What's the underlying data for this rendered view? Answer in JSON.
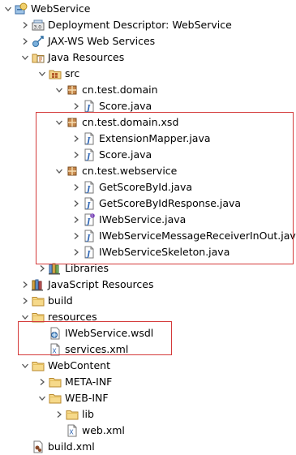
{
  "accent_highlight_color": "#d43a3a",
  "tree": [
    {
      "label": "WebService",
      "depth": 0,
      "arrow": "open",
      "icon": "project-icon"
    },
    {
      "label": "Deployment Descriptor: WebService",
      "depth": 1,
      "arrow": "closed",
      "icon": "deployment-descriptor-icon"
    },
    {
      "label": "JAX-WS Web Services",
      "depth": 1,
      "arrow": "closed",
      "icon": "jaxws-icon"
    },
    {
      "label": "Java Resources",
      "depth": 1,
      "arrow": "open",
      "icon": "java-resources-icon"
    },
    {
      "label": "src",
      "depth": 2,
      "arrow": "open",
      "icon": "source-folder-icon"
    },
    {
      "label": "cn.test.domain",
      "depth": 3,
      "arrow": "open",
      "icon": "package-icon"
    },
    {
      "label": "Score.java",
      "depth": 4,
      "arrow": "closed",
      "icon": "java-file-icon"
    },
    {
      "label": "cn.test.domain.xsd",
      "depth": 3,
      "arrow": "open",
      "icon": "package-icon"
    },
    {
      "label": "ExtensionMapper.java",
      "depth": 4,
      "arrow": "closed",
      "icon": "java-file-icon"
    },
    {
      "label": "Score.java",
      "depth": 4,
      "arrow": "closed",
      "icon": "java-file-icon"
    },
    {
      "label": "cn.test.webservice",
      "depth": 3,
      "arrow": "open",
      "icon": "package-icon"
    },
    {
      "label": "GetScoreById.java",
      "depth": 4,
      "arrow": "closed",
      "icon": "java-file-icon"
    },
    {
      "label": "GetScoreByIdResponse.java",
      "depth": 4,
      "arrow": "closed",
      "icon": "java-file-icon"
    },
    {
      "label": "IWebService.java",
      "depth": 4,
      "arrow": "closed",
      "icon": "java-interface-file-icon"
    },
    {
      "label": "IWebServiceMessageReceiverInOut.java",
      "depth": 4,
      "arrow": "closed",
      "icon": "java-file-icon"
    },
    {
      "label": "IWebServiceSkeleton.java",
      "depth": 4,
      "arrow": "closed",
      "icon": "java-file-icon"
    },
    {
      "label": "Libraries",
      "depth": 2,
      "arrow": "closed",
      "icon": "libraries-icon"
    },
    {
      "label": "JavaScript Resources",
      "depth": 1,
      "arrow": "closed",
      "icon": "javascript-resources-icon"
    },
    {
      "label": "build",
      "depth": 1,
      "arrow": "closed",
      "icon": "folder-icon"
    },
    {
      "label": "resources",
      "depth": 1,
      "arrow": "open",
      "icon": "folder-icon"
    },
    {
      "label": "IWebService.wsdl",
      "depth": 2,
      "arrow": "none",
      "icon": "wsdl-file-icon"
    },
    {
      "label": "services.xml",
      "depth": 2,
      "arrow": "none",
      "icon": "xml-file-icon"
    },
    {
      "label": "WebContent",
      "depth": 1,
      "arrow": "open",
      "icon": "folder-icon"
    },
    {
      "label": "META-INF",
      "depth": 2,
      "arrow": "closed",
      "icon": "folder-icon"
    },
    {
      "label": "WEB-INF",
      "depth": 2,
      "arrow": "open",
      "icon": "folder-icon"
    },
    {
      "label": "lib",
      "depth": 3,
      "arrow": "closed",
      "icon": "folder-icon"
    },
    {
      "label": "web.xml",
      "depth": 3,
      "arrow": "none",
      "icon": "xml-file-icon"
    },
    {
      "label": "build.xml",
      "depth": 1,
      "arrow": "none",
      "icon": "ant-xml-file-icon"
    }
  ]
}
